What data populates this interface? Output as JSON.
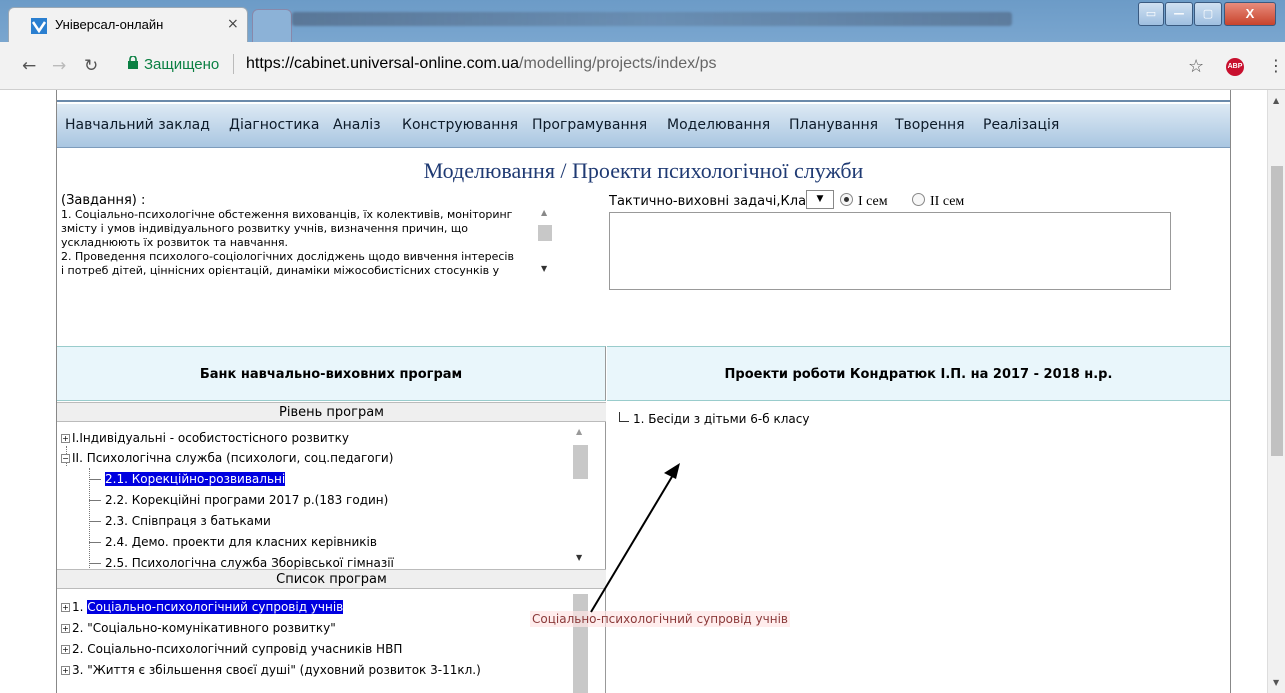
{
  "browser": {
    "tab_title": "Універсал-онлайн",
    "tab_close": "×",
    "secure_label": "Защищено",
    "url_host": "https://cabinet.universal-online.com.ua",
    "url_path": "/modelling/projects/index/ps",
    "abp_label": "ABP",
    "window_close": "X"
  },
  "menu": {
    "items": [
      "Навчальний заклад",
      "Діагностика",
      "Аналіз",
      "Конструювання",
      "Програмування",
      "Моделювання",
      "Планування",
      "Творення",
      "Реалізація"
    ]
  },
  "page": {
    "heading": "Моделювання / Проекти психологічної служби",
    "tasks_label": "(Завдання) :",
    "tasks_text": [
      "1. Соціально-психологічне обстеження вихованців, їх колективів, моніторинг",
      "змісту і умов індивідуального розвитку учнів, визначення причин, що",
      "ускладнюють їх розвиток та навчання.",
      "2. Проведення психолого-соціологічних досліджень щодо вивчення інтересів",
      "і потреб дітей, ціннісних орієнтацій, динаміки міжособистісних стосунків у"
    ],
    "tactic_label": "Тактично-виховні задачі,Клас",
    "select_arrow": "▼",
    "radio_1": "І сем",
    "radio_2": "ІІ сем"
  },
  "left_panel": {
    "header": "Банк навчально-виховних програм",
    "level_title": "Рівень програм",
    "levels": [
      "І.Індивідуальні - особистостісного розвитку",
      "ІІ. Психологічна служба (психологи, соц.педагоги)",
      "2.1. Корекційно-розвивальні",
      "2.2. Корекційні програми 2017 р.(183 годин)",
      "2.3. Співпраця з батьками",
      "2.4. Демо. проекти для класних керівників",
      "2.5. Психологічна служба Зборівської гімназії"
    ],
    "list_title": "Список програм",
    "programs": [
      "1. ",
      "Соціально-психологічний супровід учнів",
      "2. \"Соціально-комунікативного розвитку\"",
      "2.  Соціально-психологічний супровід учасників НВП",
      "3. \"Життя є збільшення своєї душі\" (духовний розвиток 3-11кл.)"
    ]
  },
  "right_panel": {
    "header": "Проекти роботи Кондратюк І.П. на 2017 - 2018 н.р.",
    "items": [
      "1. Бесіди з дітьми 6-б класу"
    ]
  },
  "drag_ghost": "Соціально-психологічний супровід учнів",
  "colors": {
    "menubar_top": "#dde9f4",
    "menubar_bottom": "#a9c6e1",
    "heading": "#1f3a73",
    "highlight": "#0000e0",
    "column_header_bg": "#e9f6fb",
    "secure_green": "#0b8043"
  }
}
